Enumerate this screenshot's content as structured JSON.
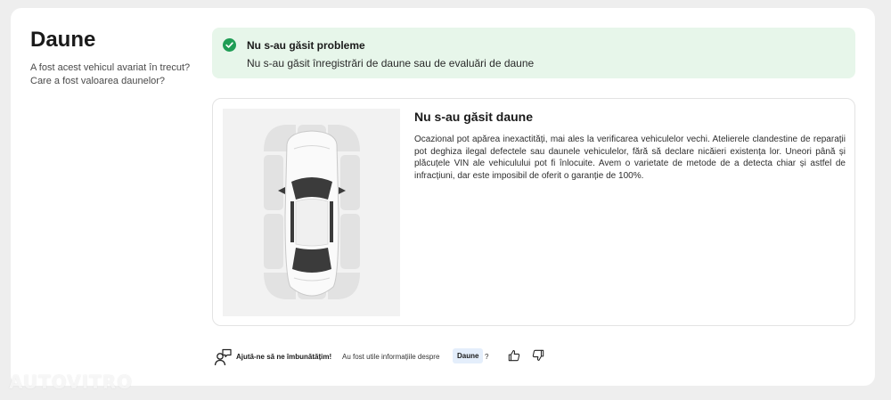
{
  "section": {
    "title": "Daune",
    "subtitle": "A fost acest vehicul avariat în trecut? Care a fost valoarea daunelor?"
  },
  "alert": {
    "icon": "check-circle-icon",
    "title": "Nu s-au găsit probleme",
    "text": "Nu s-au găsit înregistrări de daune sau de evaluări de daune",
    "color": "#e7f6ea",
    "accent": "#1f9d55"
  },
  "result": {
    "title": "Nu s-au găsit daune",
    "description": "Ocazional pot apărea inexactități, mai ales la verificarea vehiculelor vechi. Atelierele clandestine de reparații pot deghiza ilegal defectele sau daunele vehiculelor, fără să declare nicăieri existența lor. Uneori până și plăcuțele VIN ale vehiculului pot fi înlocuite. Avem o varietate de metode de a detecta chiar și astfel de infracțiuni, dar este imposibil de oferit o garanție de 100%.",
    "image": "car-top-view-diagram"
  },
  "feedback": {
    "icon": "feedback-users-icon",
    "strong": "Ajută-ne să ne îmbunătățim!",
    "question": "Au fost utile informațiile despre",
    "topic": "Daune",
    "qmark": "?",
    "like_icon": "thumbs-up-icon",
    "dislike_icon": "thumbs-down-icon"
  },
  "watermark": "AUTOVITRO"
}
